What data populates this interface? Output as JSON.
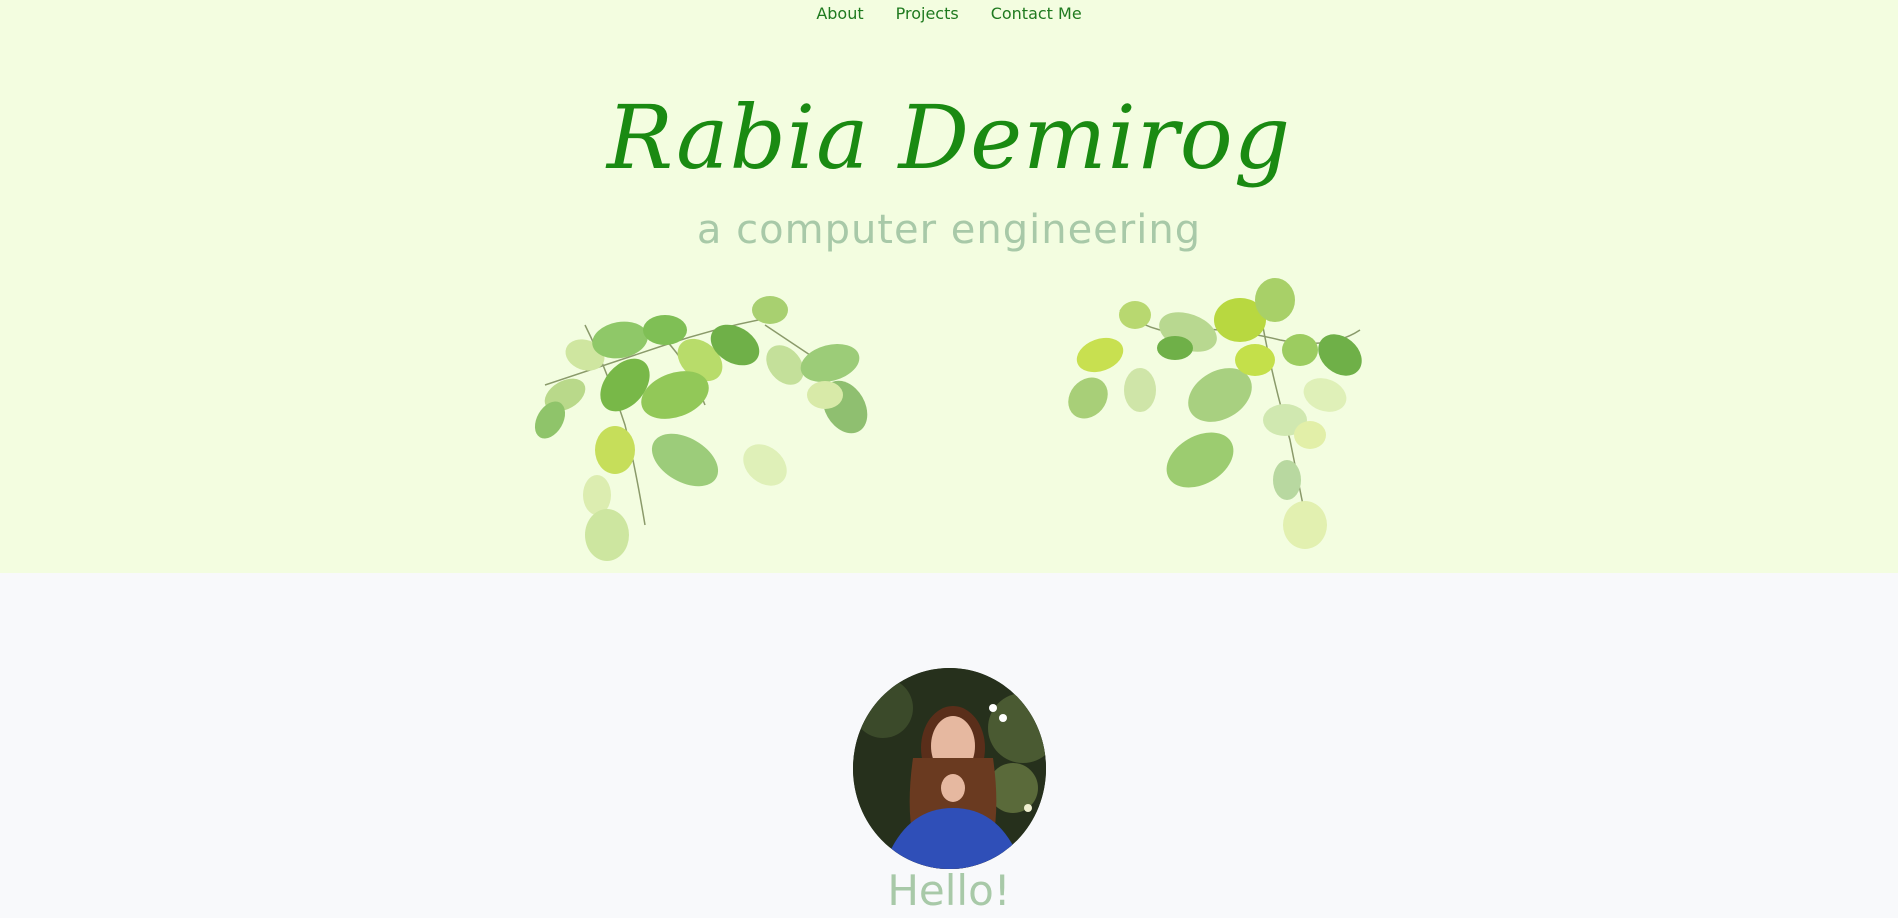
{
  "nav": {
    "items": [
      {
        "label": "About"
      },
      {
        "label": "Projects"
      },
      {
        "label": "Contact Me"
      }
    ]
  },
  "hero": {
    "name": "Rabia Demirog",
    "tagline": "a computer engineering"
  },
  "intro": {
    "greeting": "Hello!"
  },
  "colors": {
    "hero_bg": "#f3fde0",
    "page_bg": "#f8f9fb",
    "accent_green": "#1a8a12",
    "muted_green": "#a8c9a8"
  }
}
